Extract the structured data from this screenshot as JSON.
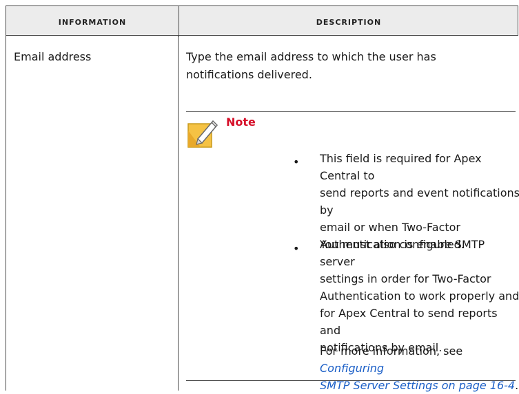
{
  "header": {
    "col1": "Information",
    "col2": "Description"
  },
  "row": {
    "field": "Email address",
    "description_line1": "Type the email address to which the user has",
    "description_line2": "notifications delivered."
  },
  "note": {
    "title": "Note",
    "bullet_symbol": "•",
    "bullets": [
      {
        "lines": [
          "This field is required for Apex Central to",
          "send reports and event notifications by",
          "email or when Two-Factor",
          "Authentication is enabled."
        ]
      },
      {
        "lines": [
          "You must also configure SMTP server",
          "settings in order for Two-Factor",
          "Authentication to work properly and",
          "for Apex Central to send reports and",
          "notifications by email."
        ]
      }
    ],
    "more_info_prefix": "For more information, see ",
    "link_line1": "Configuring",
    "link_line2": "SMTP Server Settings on page 16-4",
    "suffix": "."
  },
  "colors": {
    "header_bg": "#ececec",
    "note_red": "#d6102a",
    "link_blue": "#1b5fc7",
    "note_yellow": "#f5c244"
  }
}
